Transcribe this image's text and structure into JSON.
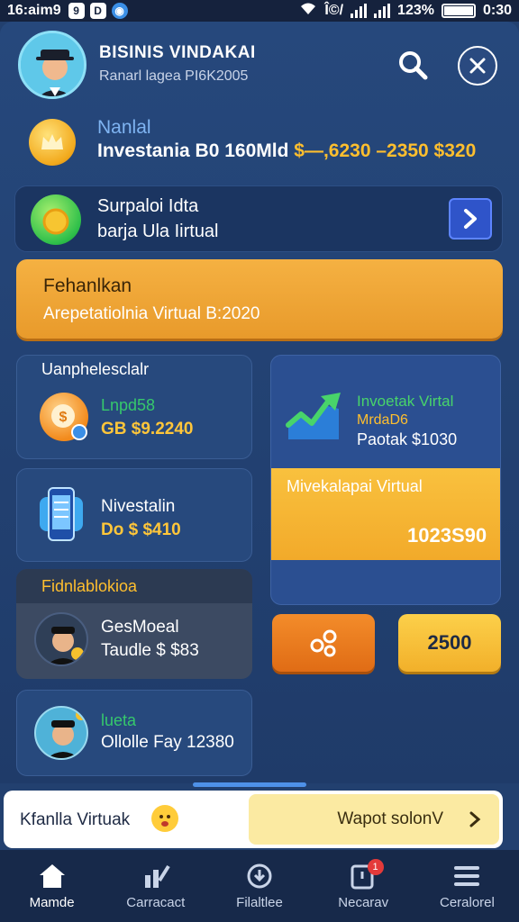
{
  "status_bar": {
    "time": "16:aim9",
    "badges": [
      "9",
      "D"
    ],
    "signal_text": "Î©/",
    "battery": "123%",
    "clock": "0:30"
  },
  "header": {
    "title": "BISINIS VINDAKAI",
    "subtitle": "Ranarl lagea PI6K2005"
  },
  "investment": {
    "label": "Nanlal",
    "text": "Investania B0 160Mld",
    "amount": "$—,6230 –2350 $320"
  },
  "promo_card": {
    "line1": "Surpaloi Idta",
    "line2": "barja Ula Iirtual"
  },
  "orange_banner": {
    "title": "Fehanlkan",
    "text": "Arepetatiolnia Virtual B:2020"
  },
  "left_cards": {
    "section1_label": "Uanphelesclalr",
    "card1": {
      "title": "Lnpd58",
      "value": "GB $9.2240"
    },
    "card2": {
      "title": "Nivestalin",
      "value": "Do $ $410"
    },
    "section2_label": "Fidnlablokioa",
    "card3": {
      "title": "GesMoeal",
      "value": "Taudle $ $83"
    },
    "card4": {
      "title": "lueta",
      "value": "Ollolle Fay 12380"
    }
  },
  "right_card": {
    "title": "Invoetak Virtal",
    "subtitle": "MrdaD6",
    "detail": "Paotak $1030",
    "yellow_label": "Mivekalapai Virtual",
    "yellow_value": "1023S90"
  },
  "action_buttons": {
    "orange_icon": "share-icon",
    "yellow_label": "2500"
  },
  "bottom_banner": {
    "text": "Kfanlla Virtuak",
    "cta_label": "Wapot solonV"
  },
  "nav": {
    "items": [
      {
        "label": "Mamde",
        "icon": "home-icon"
      },
      {
        "label": "Carracact",
        "icon": "chart-icon"
      },
      {
        "label": "Filaltlee",
        "icon": "download-icon"
      },
      {
        "label": "Necarav",
        "icon": "notification-icon",
        "badge": "1"
      },
      {
        "label": "Ceralorel",
        "icon": "menu-icon"
      }
    ]
  },
  "colors": {
    "background": "#22406f",
    "accent_orange": "#f5b142",
    "accent_yellow": "#ffbf2e",
    "accent_green": "#36c86c",
    "nav_bg": "#17294a"
  }
}
